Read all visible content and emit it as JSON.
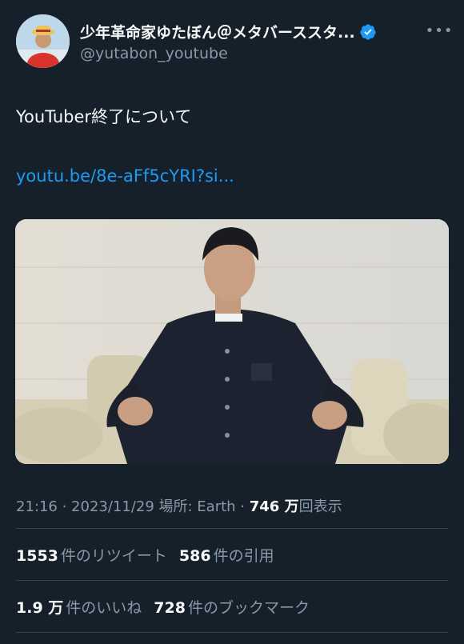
{
  "author": {
    "display_name": "少年革命家ゆたぼん＠メタバーススタ...",
    "handle": "@yutabon_youtube",
    "verified_color": "#1d9bf0"
  },
  "tweet": {
    "text": "YouTuber終了について",
    "link": "youtu.be/8e-aFf5cYRI?si..."
  },
  "meta": {
    "time": "21:16",
    "sep1": " · ",
    "date": "2023/11/29",
    "location": " 場所: Earth",
    "sep2": " · ",
    "views_num": "746 万",
    "views_label": "回表示"
  },
  "stats": {
    "retweets_num": "1553",
    "retweets_label": "件のリツイート",
    "quotes_num": "586",
    "quotes_label": "件の引用",
    "likes_num": "1.9 万",
    "likes_label": "件のいいね",
    "bookmarks_num": "728",
    "bookmarks_label": "件のブックマーク"
  },
  "colors": {
    "background": "#15202b",
    "link": "#1d9bf0",
    "secondary_text": "#8b98a5",
    "divider": "#38444d"
  },
  "icons": {
    "more": "more-horizontal-icon",
    "verified": "verified-badge-icon"
  }
}
